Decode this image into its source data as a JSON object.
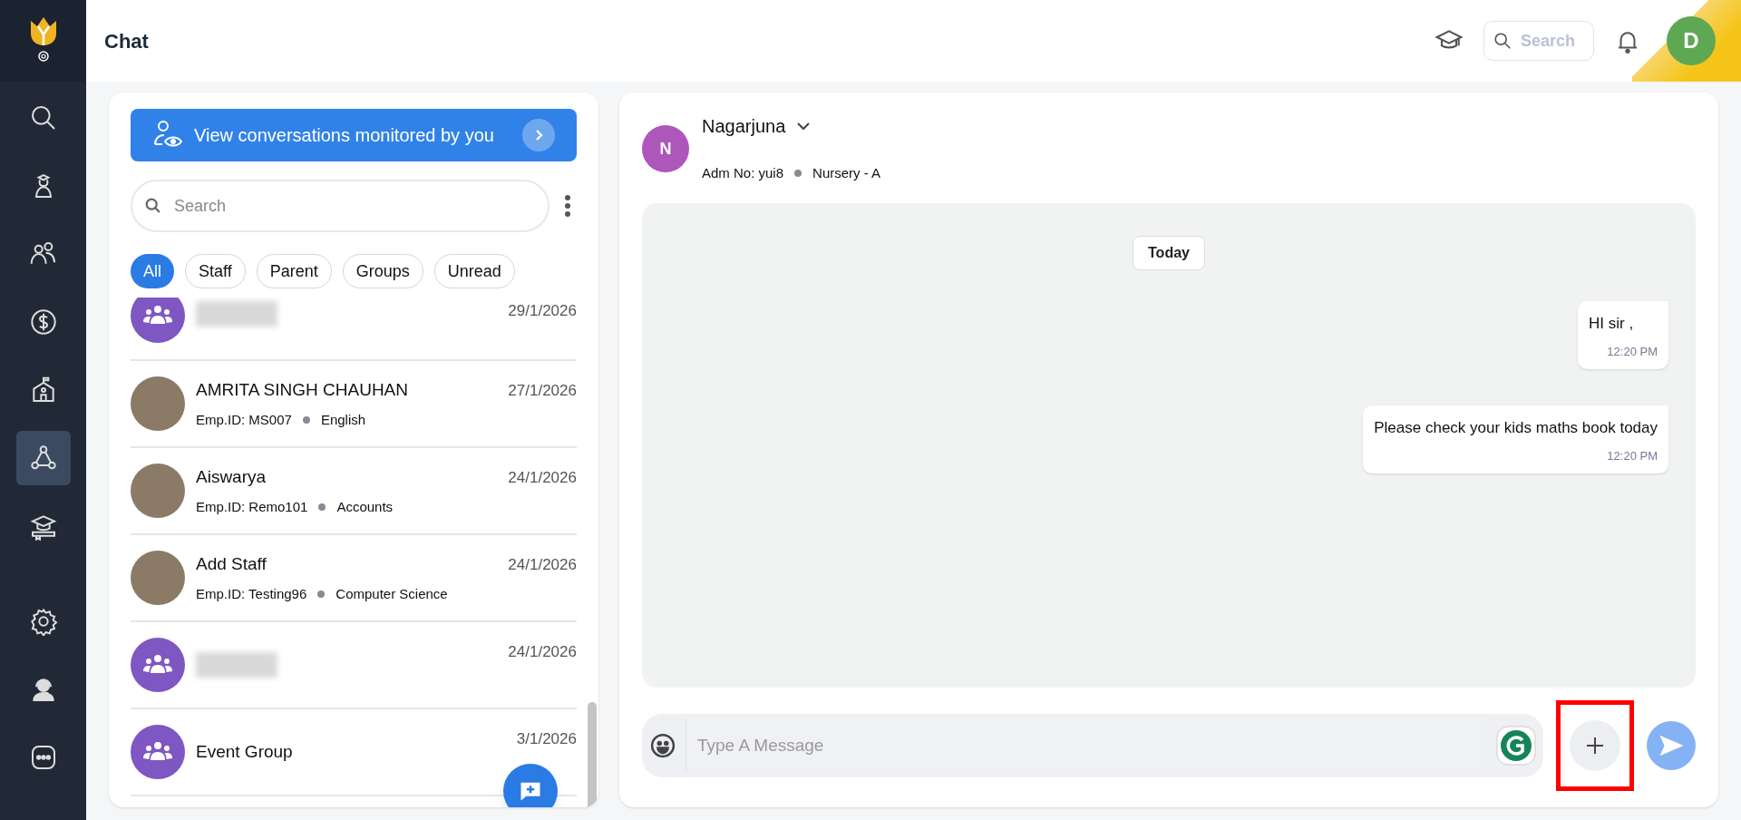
{
  "header": {
    "title": "Chat",
    "search": {
      "placeholder": "Search"
    },
    "avatar_initial": "D"
  },
  "nav": [
    {
      "selected": false
    },
    {
      "selected": false
    },
    {
      "selected": false
    },
    {
      "selected": false
    },
    {
      "selected": false
    },
    {
      "selected": true
    },
    {
      "selected": false
    },
    {
      "selected": false
    },
    {
      "selected": false
    },
    {
      "selected": false
    }
  ],
  "monitor_banner": "View conversations monitored by you",
  "list_search": {
    "placeholder": "Search"
  },
  "filters": [
    {
      "label": "All",
      "selected": true
    },
    {
      "label": "Staff",
      "selected": false
    },
    {
      "label": "Parent",
      "selected": false
    },
    {
      "label": "Groups",
      "selected": false
    },
    {
      "label": "Unread",
      "selected": false
    }
  ],
  "chats": [
    {
      "kind": "group",
      "name_blurred": true,
      "date": "29/1/2026"
    },
    {
      "kind": "person",
      "name": "AMRITA SINGH CHAUHAN",
      "emp_id": "Emp.ID: MS007",
      "dept": "English",
      "date": "27/1/2026"
    },
    {
      "kind": "person",
      "name": "Aiswarya",
      "emp_id": "Emp.ID: Remo101",
      "dept": "Accounts",
      "date": "24/1/2026"
    },
    {
      "kind": "person",
      "name": "Add Staff",
      "emp_id": "Emp.ID: Testing96",
      "dept": "Computer Science",
      "date": "24/1/2026"
    },
    {
      "kind": "group",
      "name_blurred": true,
      "date": "24/1/2026"
    },
    {
      "kind": "group",
      "name": "Event Group",
      "date": "3/1/2026"
    }
  ],
  "contact": {
    "initial": "N",
    "name": "Nagarjuna",
    "adm_no": "Adm No: yui8",
    "class": "Nursery - A"
  },
  "day_label": "Today",
  "messages": [
    {
      "text": "HI sir ,",
      "time": "12:20 PM"
    },
    {
      "text": "Please check your kids maths book today",
      "time": "12:20 PM"
    }
  ],
  "composer": {
    "placeholder": "Type A Message",
    "attach_highlighted": true
  }
}
